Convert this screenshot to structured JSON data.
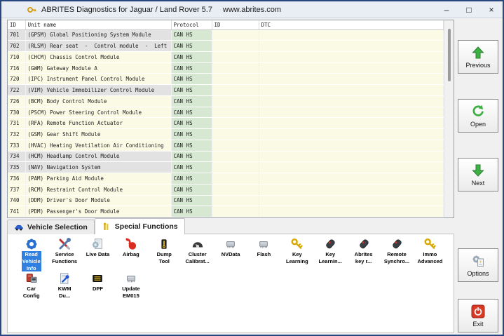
{
  "window": {
    "title": "ABRITES Diagnostics for Jaguar / Land Rover 5.7",
    "website": "www.abrites.com",
    "logo_icon": "abrites-key-logo-icon",
    "controls": [
      {
        "name": "minimize",
        "glyph": "–"
      },
      {
        "name": "maximize",
        "glyph": "□"
      },
      {
        "name": "close",
        "glyph": "×"
      }
    ]
  },
  "module_table": {
    "columns": [
      {
        "label": "ID"
      },
      {
        "label": "Unit name"
      },
      {
        "label": "Protocol"
      },
      {
        "label": "ID"
      },
      {
        "label": "DTC"
      }
    ],
    "rows": [
      {
        "id": "701",
        "unit_name": "(GPSM) Global Positioning System Module",
        "protocol": "CAN HS",
        "id2": "",
        "dtc": "",
        "shaded": true
      },
      {
        "id": "702",
        "unit_name": "(RLSM) Rear seat  -  Control module  -  Left",
        "protocol": "CAN HS",
        "id2": "",
        "dtc": "",
        "shaded": true
      },
      {
        "id": "710",
        "unit_name": "(CHCM) Chassis Control Module",
        "protocol": "CAN HS",
        "id2": "",
        "dtc": "",
        "shaded": false
      },
      {
        "id": "716",
        "unit_name": "(GWM) Gateway Module A",
        "protocol": "CAN HS",
        "id2": "",
        "dtc": "",
        "shaded": false
      },
      {
        "id": "720",
        "unit_name": "(IPC) Instrument Panel Control Module",
        "protocol": "CAN HS",
        "id2": "",
        "dtc": "",
        "shaded": false
      },
      {
        "id": "722",
        "unit_name": "(VIM) Vehicle Immobilizer Control Module",
        "protocol": "CAN HS",
        "id2": "",
        "dtc": "",
        "shaded": true
      },
      {
        "id": "726",
        "unit_name": "(BCM) Body Control Module",
        "protocol": "CAN HS",
        "id2": "",
        "dtc": "",
        "shaded": false
      },
      {
        "id": "730",
        "unit_name": "(PSCM) Power Steering Control Module",
        "protocol": "CAN HS",
        "id2": "",
        "dtc": "",
        "shaded": false
      },
      {
        "id": "731",
        "unit_name": "(RFA) Remote Function Actuator",
        "protocol": "CAN HS",
        "id2": "",
        "dtc": "",
        "shaded": false
      },
      {
        "id": "732",
        "unit_name": "(GSM) Gear Shift Module",
        "protocol": "CAN HS",
        "id2": "",
        "dtc": "",
        "shaded": false
      },
      {
        "id": "733",
        "unit_name": "(HVAC) Heating Ventilation Air Conditioning",
        "protocol": "CAN HS",
        "id2": "",
        "dtc": "",
        "shaded": false
      },
      {
        "id": "734",
        "unit_name": "(HCM) Headlamp Control Module",
        "protocol": "CAN HS",
        "id2": "",
        "dtc": "",
        "shaded": true
      },
      {
        "id": "735",
        "unit_name": "(NAV) Navigation System",
        "protocol": "CAN HS",
        "id2": "",
        "dtc": "",
        "shaded": true
      },
      {
        "id": "736",
        "unit_name": "(PAM) Parking Aid Module",
        "protocol": "CAN HS",
        "id2": "",
        "dtc": "",
        "shaded": false
      },
      {
        "id": "737",
        "unit_name": "(RCM) Restraint Control Module",
        "protocol": "CAN HS",
        "id2": "",
        "dtc": "",
        "shaded": false
      },
      {
        "id": "740",
        "unit_name": "(DDM) Driver's Door Module",
        "protocol": "CAN HS",
        "id2": "",
        "dtc": "",
        "shaded": false
      },
      {
        "id": "741",
        "unit_name": "(PDM) Passenger's Door Module",
        "protocol": "CAN HS",
        "id2": "",
        "dtc": "",
        "shaded": false
      }
    ]
  },
  "tabs": [
    {
      "label": "Vehicle Selection",
      "icon": "car-icon",
      "active": false
    },
    {
      "label": "Special Functions",
      "icon": "tools-icon",
      "active": true
    }
  ],
  "special_functions": {
    "rows": [
      [
        {
          "label": "Read\nVehicle\nInfo",
          "icon": "gear-blue-icon",
          "selected": true
        },
        {
          "label": "Service\nFunctions",
          "icon": "crossed-tools-icon",
          "selected": false
        },
        {
          "label": "Live Data",
          "icon": "doc-gear-icon",
          "selected": false
        },
        {
          "label": "Airbag",
          "icon": "airbag-icon",
          "selected": false
        },
        {
          "label": "Dump\nTool",
          "icon": "dump-tool-icon",
          "selected": false
        },
        {
          "label": "Cluster\nCalibrat...",
          "icon": "cluster-icon",
          "selected": false
        },
        {
          "label": "NVData",
          "icon": "chip-icon",
          "selected": false
        },
        {
          "label": "Flash",
          "icon": "chip-icon",
          "selected": false
        },
        {
          "label": "Key\nLearning",
          "icon": "key-icon",
          "selected": false
        },
        {
          "label": "Key\nLearnin...",
          "icon": "remote-icon",
          "selected": false
        },
        {
          "label": "Abrites\nkey r...",
          "icon": "remote-icon",
          "selected": false
        },
        {
          "label": "Remote\nSynchro...",
          "icon": "remote-icon",
          "selected": false
        },
        {
          "label": "Immo\nAdvanced",
          "icon": "key-icon",
          "selected": false
        }
      ],
      [
        {
          "label": "Car\nConfig",
          "icon": "car-config-icon",
          "selected": false
        },
        {
          "label": "KWM\nDu...",
          "icon": "doc-wrench-icon",
          "selected": false
        },
        {
          "label": "DPF",
          "icon": "dpf-icon",
          "selected": false
        },
        {
          "label": "Update\nEM015",
          "icon": "chip-icon",
          "selected": false
        }
      ]
    ]
  },
  "nav_buttons": [
    {
      "label": "Previous",
      "icon": "arrow-up-icon"
    },
    {
      "label": "Open",
      "icon": "rotate-arrow-icon"
    },
    {
      "label": "Next",
      "icon": "arrow-down-icon"
    }
  ],
  "action_buttons": [
    {
      "label": "Options",
      "icon": "options-gear-icon"
    },
    {
      "label": "Exit",
      "icon": "power-icon"
    }
  ],
  "colors": {
    "row_yellow": "#fbfbe5",
    "row_shaded": "#e2e2e2",
    "protocol_green": "#d6e8d2",
    "selected_blue": "#2f80e0",
    "arrow_green": "#3cb043",
    "exit_red": "#d93a26",
    "titlebar": "#e9eef5",
    "panel_gray": "#f0f0f0",
    "window_border": "#27477e"
  }
}
